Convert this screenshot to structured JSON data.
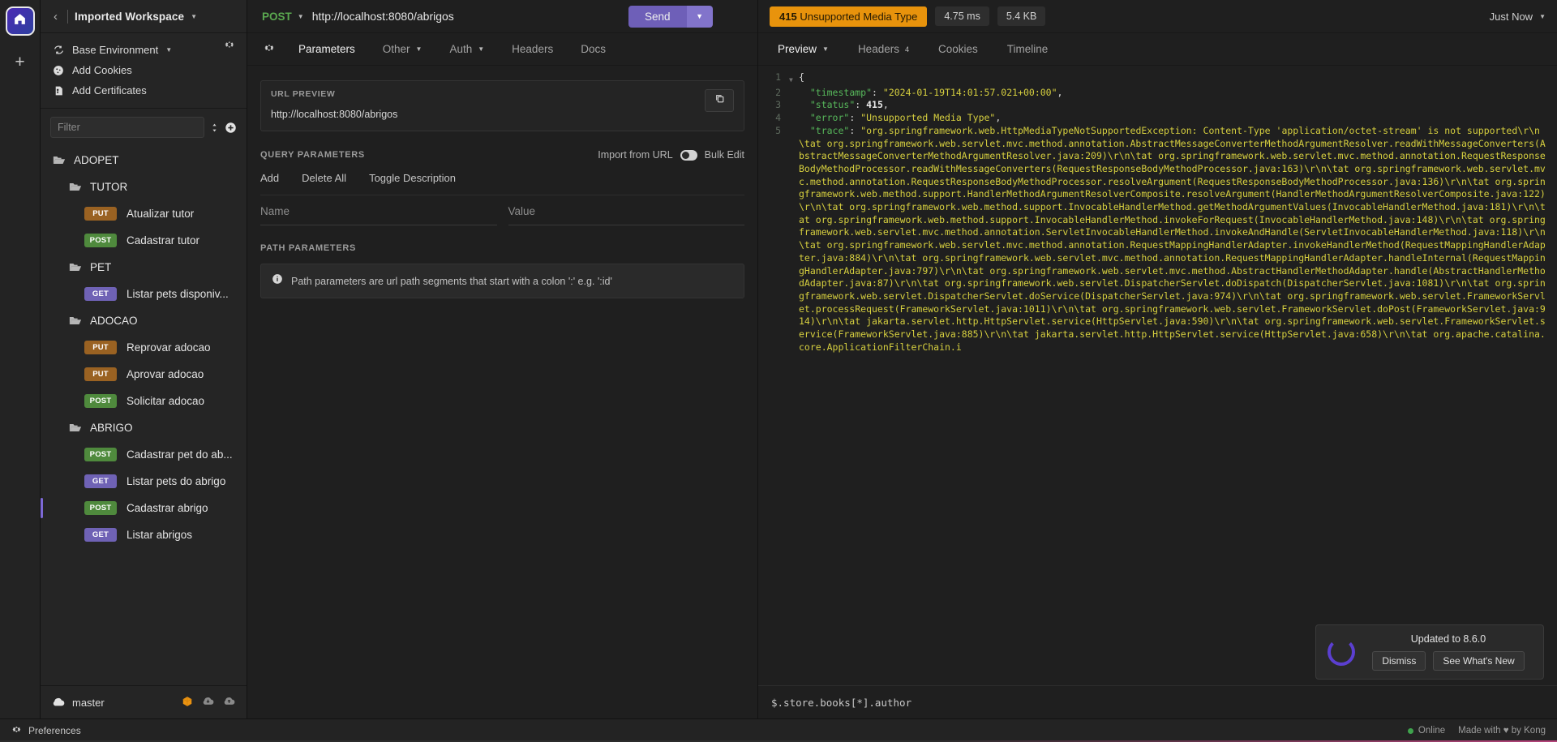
{
  "rail": {
    "home_icon": "home-icon",
    "add_icon": "plus-icon"
  },
  "sidebar": {
    "back_icon": "chevron-left-icon",
    "workspace_title": "Imported Workspace",
    "env_items": [
      {
        "icon": "sync-icon",
        "label": "Base Environment",
        "has_caret": true
      },
      {
        "icon": "cookie-icon",
        "label": "Add Cookies",
        "has_caret": false
      },
      {
        "icon": "certificate-icon",
        "label": "Add Certificates",
        "has_caret": false
      }
    ],
    "filter_placeholder": "Filter",
    "filter_value": "",
    "tree": [
      {
        "kind": "folder",
        "label": "ADOPET",
        "indent": 0
      },
      {
        "kind": "folder",
        "label": "TUTOR",
        "indent": 1
      },
      {
        "kind": "request",
        "method": "PUT",
        "label": "Atualizar tutor",
        "indent": 2
      },
      {
        "kind": "request",
        "method": "POST",
        "label": "Cadastrar tutor",
        "indent": 2
      },
      {
        "kind": "folder",
        "label": "PET",
        "indent": 1
      },
      {
        "kind": "request",
        "method": "GET",
        "label": "Listar pets disponiv...",
        "indent": 2
      },
      {
        "kind": "folder",
        "label": "ADOCAO",
        "indent": 1
      },
      {
        "kind": "request",
        "method": "PUT",
        "label": "Reprovar adocao",
        "indent": 2
      },
      {
        "kind": "request",
        "method": "PUT",
        "label": "Aprovar adocao",
        "indent": 2
      },
      {
        "kind": "request",
        "method": "POST",
        "label": "Solicitar adocao",
        "indent": 2
      },
      {
        "kind": "folder",
        "label": "ABRIGO",
        "indent": 1
      },
      {
        "kind": "request",
        "method": "POST",
        "label": "Cadastrar pet do ab...",
        "indent": 2
      },
      {
        "kind": "request",
        "method": "GET",
        "label": "Listar pets do abrigo",
        "indent": 2
      },
      {
        "kind": "request",
        "method": "POST",
        "label": "Cadastrar abrigo",
        "indent": 2,
        "selected": true
      },
      {
        "kind": "request",
        "method": "GET",
        "label": "Listar abrigos",
        "indent": 2
      }
    ],
    "footer": {
      "branch_icon": "cloud-icon",
      "branch": "master",
      "icons": [
        "package-icon",
        "cloud-download-icon",
        "cloud-upload-icon"
      ]
    }
  },
  "request": {
    "method": "POST",
    "url": "http://localhost:8080/abrigos",
    "settings_icon": "gear-icon",
    "tabs": [
      {
        "label": "Parameters",
        "active": true,
        "caret": false
      },
      {
        "label": "Other",
        "active": false,
        "caret": true
      },
      {
        "label": "Auth",
        "active": false,
        "caret": true
      },
      {
        "label": "Headers",
        "active": false,
        "caret": false
      },
      {
        "label": "Docs",
        "active": false,
        "caret": false
      }
    ],
    "url_preview": {
      "title": "URL PREVIEW",
      "value": "http://localhost:8080/abrigos",
      "copy_icon": "copy-icon"
    },
    "query_parameters": {
      "title": "QUERY PARAMETERS",
      "import_from_url": "Import from URL",
      "bulk_edit": "Bulk Edit",
      "actions": [
        "Add",
        "Delete All",
        "Toggle Description"
      ],
      "name_placeholder": "Name",
      "value_placeholder": "Value",
      "name_value": "",
      "value_value": ""
    },
    "path_parameters": {
      "title": "PATH PARAMETERS",
      "info_icon": "info-icon",
      "info_text": "Path parameters are url path segments that start with a colon ':' e.g. ':id'"
    },
    "send_label": "Send",
    "send_caret_icon": "chevron-down-icon"
  },
  "response": {
    "status_code": "415",
    "status_text": "Unsupported Media Type",
    "time": "4.75 ms",
    "size": "5.4 KB",
    "just_now": "Just Now",
    "tabs": [
      {
        "label": "Preview",
        "active": true,
        "caret": true,
        "badge": ""
      },
      {
        "label": "Headers",
        "active": false,
        "caret": false,
        "badge": "4"
      },
      {
        "label": "Cookies",
        "active": false,
        "caret": false,
        "badge": ""
      },
      {
        "label": "Timeline",
        "active": false,
        "caret": false,
        "badge": ""
      }
    ],
    "filter_expression": "$.store.books[*].author",
    "body_lines": [
      {
        "n": "1",
        "fold": true,
        "tokens": [
          {
            "t": "{",
            "c": "p"
          }
        ]
      },
      {
        "n": "2",
        "fold": false,
        "tokens": [
          {
            "t": "  \"timestamp\"",
            "c": "k"
          },
          {
            "t": ": ",
            "c": "p"
          },
          {
            "t": "\"2024-01-19T14:01:57.021+00:00\"",
            "c": "s"
          },
          {
            "t": ",",
            "c": "p"
          }
        ]
      },
      {
        "n": "3",
        "fold": false,
        "tokens": [
          {
            "t": "  \"status\"",
            "c": "k"
          },
          {
            "t": ": ",
            "c": "p"
          },
          {
            "t": "415",
            "c": "n"
          },
          {
            "t": ",",
            "c": "p"
          }
        ]
      },
      {
        "n": "4",
        "fold": false,
        "tokens": [
          {
            "t": "  \"error\"",
            "c": "k"
          },
          {
            "t": ": ",
            "c": "p"
          },
          {
            "t": "\"Unsupported Media Type\"",
            "c": "s"
          },
          {
            "t": ",",
            "c": "p"
          }
        ]
      },
      {
        "n": "5",
        "fold": false,
        "tokens": [
          {
            "t": "  \"trace\"",
            "c": "k"
          },
          {
            "t": ": ",
            "c": "p"
          },
          {
            "t": "\"org.springframework.web.HttpMediaTypeNotSupportedException: Content-Type 'application/octet-stream' is not supported\\r\\n\\tat org.springframework.web.servlet.mvc.method.annotation.AbstractMessageConverterMethodArgumentResolver.readWithMessageConverters(AbstractMessageConverterMethodArgumentResolver.java:209)\\r\\n\\tat org.springframework.web.servlet.mvc.method.annotation.RequestResponseBodyMethodProcessor.readWithMessageConverters(RequestResponseBodyMethodProcessor.java:163)\\r\\n\\tat org.springframework.web.servlet.mvc.method.annotation.RequestResponseBodyMethodProcessor.resolveArgument(RequestResponseBodyMethodProcessor.java:136)\\r\\n\\tat org.springframework.web.method.support.HandlerMethodArgumentResolverComposite.resolveArgument(HandlerMethodArgumentResolverComposite.java:122)\\r\\n\\tat org.springframework.web.method.support.InvocableHandlerMethod.getMethodArgumentValues(InvocableHandlerMethod.java:181)\\r\\n\\tat org.springframework.web.method.support.InvocableHandlerMethod.invokeForRequest(InvocableHandlerMethod.java:148)\\r\\n\\tat org.springframework.web.servlet.mvc.method.annotation.ServletInvocableHandlerMethod.invokeAndHandle(ServletInvocableHandlerMethod.java:118)\\r\\n\\tat org.springframework.web.servlet.mvc.method.annotation.RequestMappingHandlerAdapter.invokeHandlerMethod(RequestMappingHandlerAdapter.java:884)\\r\\n\\tat org.springframework.web.servlet.mvc.method.annotation.RequestMappingHandlerAdapter.handleInternal(RequestMappingHandlerAdapter.java:797)\\r\\n\\tat org.springframework.web.servlet.mvc.method.AbstractHandlerMethodAdapter.handle(AbstractHandlerMethodAdapter.java:87)\\r\\n\\tat org.springframework.web.servlet.DispatcherServlet.doDispatch(DispatcherServlet.java:1081)\\r\\n\\tat org.springframework.web.servlet.DispatcherServlet.doService(DispatcherServlet.java:974)\\r\\n\\tat org.springframework.web.servlet.FrameworkServlet.processRequest(FrameworkServlet.java:1011)\\r\\n\\tat org.springframework.web.servlet.FrameworkServlet.doPost(FrameworkServlet.java:914)\\r\\n\\tat jakarta.servlet.http.HttpServlet.service(HttpServlet.java:590)\\r\\n\\tat org.springframework.web.servlet.FrameworkServlet.service(FrameworkServlet.java:885)\\r\\n\\tat jakarta.servlet.http.HttpServlet.service(HttpServlet.java:658)\\r\\n\\tat org.apache.catalina.core.ApplicationFilterChain.i",
            "c": "s"
          }
        ]
      }
    ]
  },
  "toast": {
    "message": "Updated to 8.6.0",
    "dismiss_label": "Dismiss",
    "whatsnew_label": "See What's New",
    "spinner_icon": "spinner-icon"
  },
  "statusbar": {
    "preferences_icon": "gear-icon",
    "preferences_label": "Preferences",
    "online_label": "Online",
    "made_with_label": "Made with ♥ by Kong"
  },
  "colors": {
    "accent_purple": "#6e5fb8",
    "status_orange": "#e8930c",
    "get": "#6f62b5",
    "post": "#4f8a3d",
    "put": "#9a6222"
  }
}
